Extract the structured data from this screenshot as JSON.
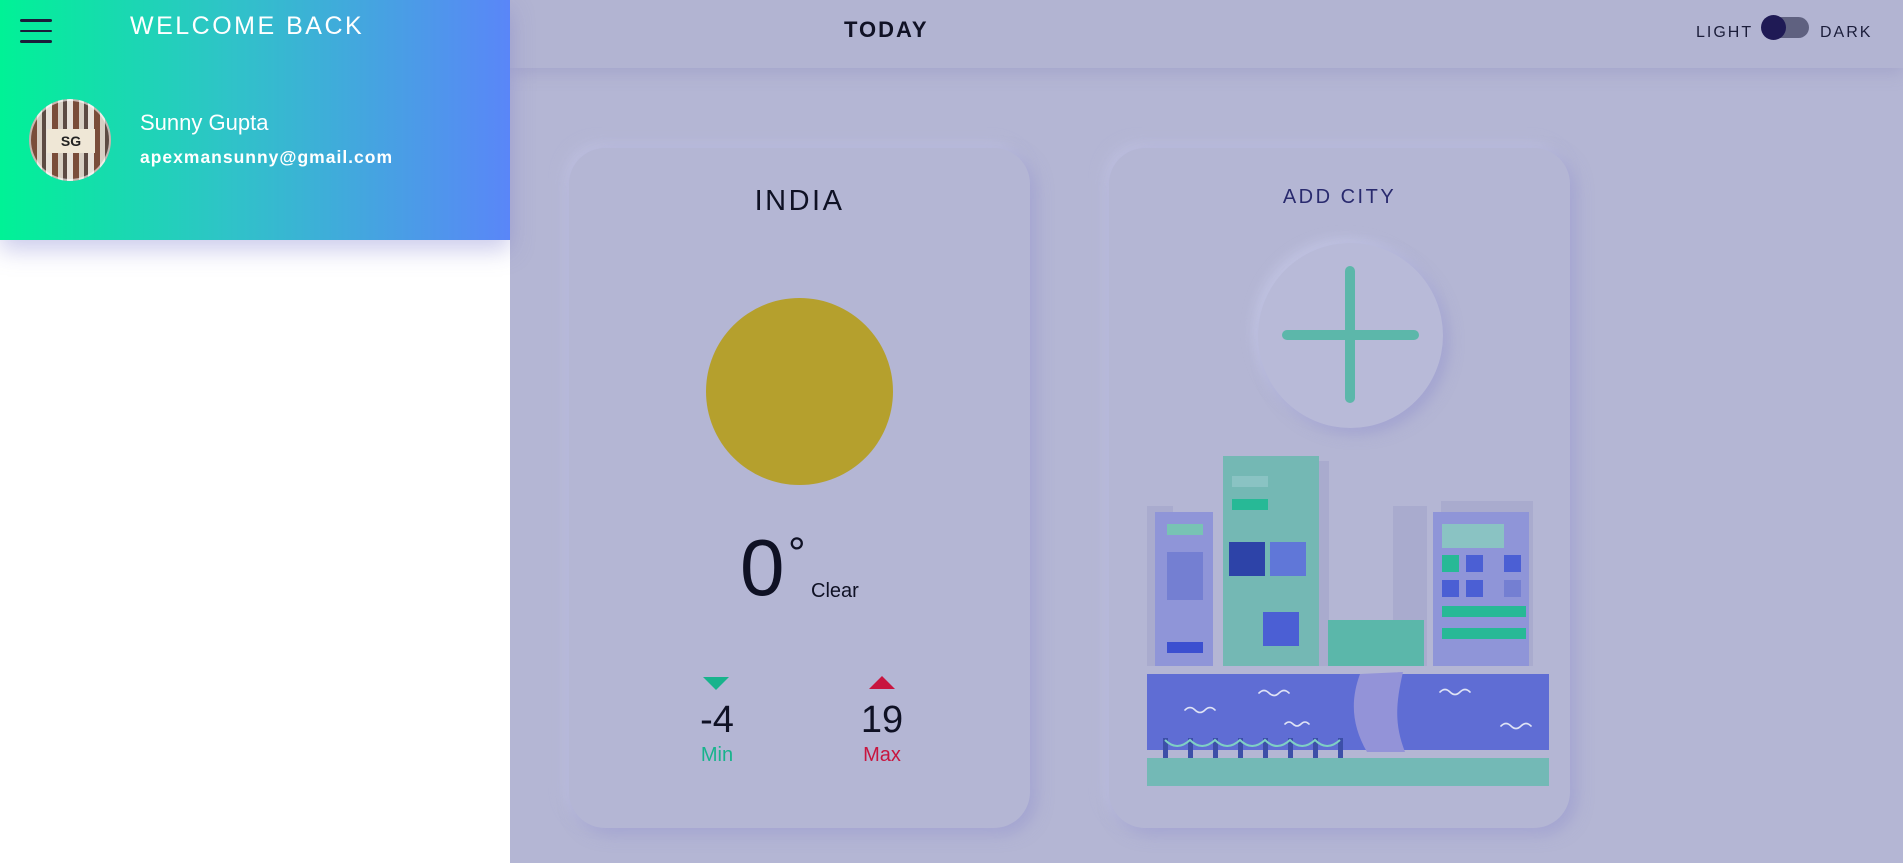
{
  "sidebar": {
    "welcome_text": "WELCOME BACK",
    "user": {
      "initials": "SG",
      "name": "Sunny Gupta",
      "email": "apexmansunny@gmail.com"
    }
  },
  "header": {
    "title": "TODAY",
    "theme_toggle": {
      "light_label": "LIGHT",
      "dark_label": "DARK",
      "state": "light"
    }
  },
  "weather_card": {
    "location": "INDIA",
    "temperature": "0",
    "degree_symbol": "°",
    "condition": "Clear",
    "min_value": "-4",
    "min_label": "Min",
    "max_value": "19",
    "max_label": "Max",
    "colors": {
      "sun": "#b5a02d",
      "min": "#18b38c",
      "max": "#c8153f"
    }
  },
  "add_city_card": {
    "title": "ADD CITY"
  },
  "icons": {
    "menu": "hamburger-icon",
    "weather": "sun-icon",
    "min": "arrow-down-icon",
    "max": "arrow-up-icon",
    "add": "plus-icon"
  }
}
